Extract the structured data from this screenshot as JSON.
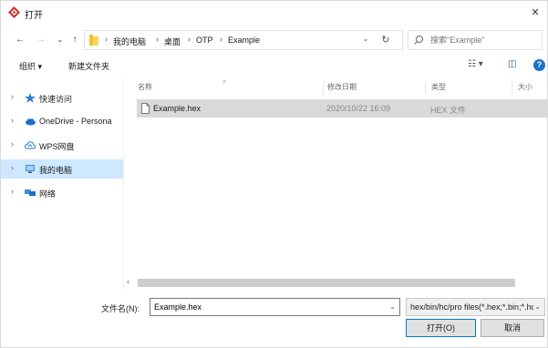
{
  "window": {
    "title": "打开",
    "close_glyph": "✕"
  },
  "nav": {
    "back": "←",
    "forward": "→",
    "recent": "⌄",
    "up": "↑"
  },
  "breadcrumb": [
    "我的电脑",
    "桌面",
    "OTP",
    "Example"
  ],
  "breadcrumb_sep": "›",
  "address": {
    "dropdown": "⌄",
    "refresh": "↻"
  },
  "search": {
    "placeholder": "搜索\"Example\""
  },
  "toolbar": {
    "organize": "组织 ▾",
    "new_folder": "新建文件夹",
    "view": "☷ ▾",
    "pane": "◫",
    "help": "?"
  },
  "sidebar": {
    "items": [
      {
        "label": "快速访问",
        "icon": "star-icon",
        "selected": false
      },
      {
        "label": "OneDrive - Persona",
        "icon": "cloud-icon",
        "selected": false
      },
      {
        "label": "WPS网盘",
        "icon": "wps-cloud-icon",
        "selected": false
      },
      {
        "label": "我的电脑",
        "icon": "computer-icon",
        "selected": true
      },
      {
        "label": "网络",
        "icon": "network-icon",
        "selected": false
      }
    ],
    "chevron": "›"
  },
  "columns": {
    "name": "名称",
    "date": "修改日期",
    "type": "类型",
    "size": "大小",
    "sort_arrow": "^"
  },
  "files": [
    {
      "name": "Example.hex",
      "date": "2020/10/22 16:09",
      "type": "HEX 文件"
    }
  ],
  "scroll": {
    "left_arrow": "‹"
  },
  "bottom": {
    "filename_label": "文件名(N):",
    "filename_value": "Example.hex",
    "filename_dropdown": "⌄",
    "filter": "hex/bin/hc/pro files(*.hex;*.bin;*.hc;*.pro)",
    "filter_dropdown": "⌄",
    "open_button": "打开(O)",
    "cancel_button": "取消"
  },
  "colors": {
    "accent": "#0078d7",
    "selected_sidebar": "#cde8ff",
    "selected_row": "#d9d9d9",
    "app_icon": "#d0302b"
  }
}
